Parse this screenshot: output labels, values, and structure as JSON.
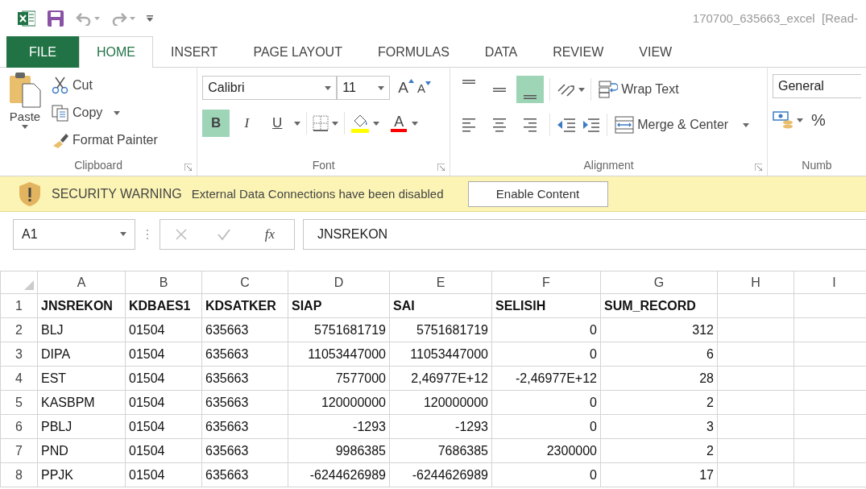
{
  "title_bar": {
    "title": "170700_635663_excel  [Read-"
  },
  "tabs": [
    {
      "label": "FILE",
      "kind": "file",
      "selected": false
    },
    {
      "label": "HOME",
      "kind": "tab",
      "selected": true
    },
    {
      "label": "INSERT",
      "kind": "tab",
      "selected": false
    },
    {
      "label": "PAGE LAYOUT",
      "kind": "tab",
      "selected": false
    },
    {
      "label": "FORMULAS",
      "kind": "tab",
      "selected": false
    },
    {
      "label": "DATA",
      "kind": "tab",
      "selected": false
    },
    {
      "label": "REVIEW",
      "kind": "tab",
      "selected": false
    },
    {
      "label": "VIEW",
      "kind": "tab",
      "selected": false
    }
  ],
  "ribbon": {
    "clipboard": {
      "paste": "Paste",
      "cut": "Cut",
      "copy": "Copy",
      "format_painter": "Format Painter",
      "label": "Clipboard"
    },
    "font": {
      "font_name": "Calibri",
      "font_size": "11",
      "grow": "A",
      "shrink": "A",
      "styles": [
        {
          "kind": "bold",
          "label": "B",
          "selected": true
        },
        {
          "kind": "italic",
          "label": "I",
          "selected": false
        },
        {
          "kind": "underline",
          "label": "U",
          "selected": false
        }
      ],
      "font_color": "A",
      "label": "Font"
    },
    "alignment": {
      "vertical": [
        {
          "kind": "top",
          "selected": false
        },
        {
          "kind": "middle",
          "selected": false
        },
        {
          "kind": "bottom",
          "selected": true
        }
      ],
      "horizontal": [
        {
          "kind": "left",
          "selected": false
        },
        {
          "kind": "center",
          "selected": false
        },
        {
          "kind": "right",
          "selected": false
        }
      ],
      "wrap_text": "Wrap Text",
      "merge_center": "Merge & Center",
      "label": "Alignment"
    },
    "number": {
      "format": "General",
      "percent": "%",
      "label": "Numb"
    }
  },
  "security_bar": {
    "title": "SECURITY WARNING",
    "message": "External Data Connections have been disabled",
    "button": "Enable Content"
  },
  "formula_bar": {
    "name_box": "A1",
    "fx": "fx",
    "value": "JNSREKON"
  },
  "sheet": {
    "columns": [
      {
        "letter": "A",
        "numeric": false
      },
      {
        "letter": "B",
        "numeric": false
      },
      {
        "letter": "C",
        "numeric": false
      },
      {
        "letter": "D",
        "numeric": true
      },
      {
        "letter": "E",
        "numeric": true
      },
      {
        "letter": "F",
        "numeric": true
      },
      {
        "letter": "G",
        "numeric": true
      },
      {
        "letter": "H"
      },
      {
        "letter": "I"
      }
    ],
    "rows": [
      {
        "number": "1",
        "kind": "header",
        "cells": [
          "JNSREKON",
          "KDBAES1",
          "KDSATKER",
          "SIAP",
          "SAI",
          "SELISIH",
          "SUM_RECORD"
        ]
      },
      {
        "number": "2",
        "kind": "data",
        "cells": [
          "BLJ",
          "01504",
          "635663",
          "5751681719",
          "5751681719",
          "0",
          "312"
        ]
      },
      {
        "number": "3",
        "kind": "data",
        "cells": [
          "DIPA",
          "01504",
          "635663",
          "11053447000",
          "11053447000",
          "0",
          "6"
        ]
      },
      {
        "number": "4",
        "kind": "data",
        "cells": [
          "EST",
          "01504",
          "635663",
          "7577000",
          "2,46977E+12",
          "-2,46977E+12",
          "28"
        ]
      },
      {
        "number": "5",
        "kind": "data",
        "cells": [
          "KASBPM",
          "01504",
          "635663",
          "120000000",
          "120000000",
          "0",
          "2"
        ]
      },
      {
        "number": "6",
        "kind": "data",
        "cells": [
          "PBLJ",
          "01504",
          "635663",
          "-1293",
          "-1293",
          "0",
          "3"
        ]
      },
      {
        "number": "7",
        "kind": "data",
        "cells": [
          "PND",
          "01504",
          "635663",
          "9986385",
          "7686385",
          "2300000",
          "2"
        ]
      },
      {
        "number": "8",
        "kind": "data",
        "cells": [
          "PPJK",
          "01504",
          "635663",
          "-6244626989",
          "-6244626989",
          "0",
          "17"
        ]
      }
    ]
  }
}
